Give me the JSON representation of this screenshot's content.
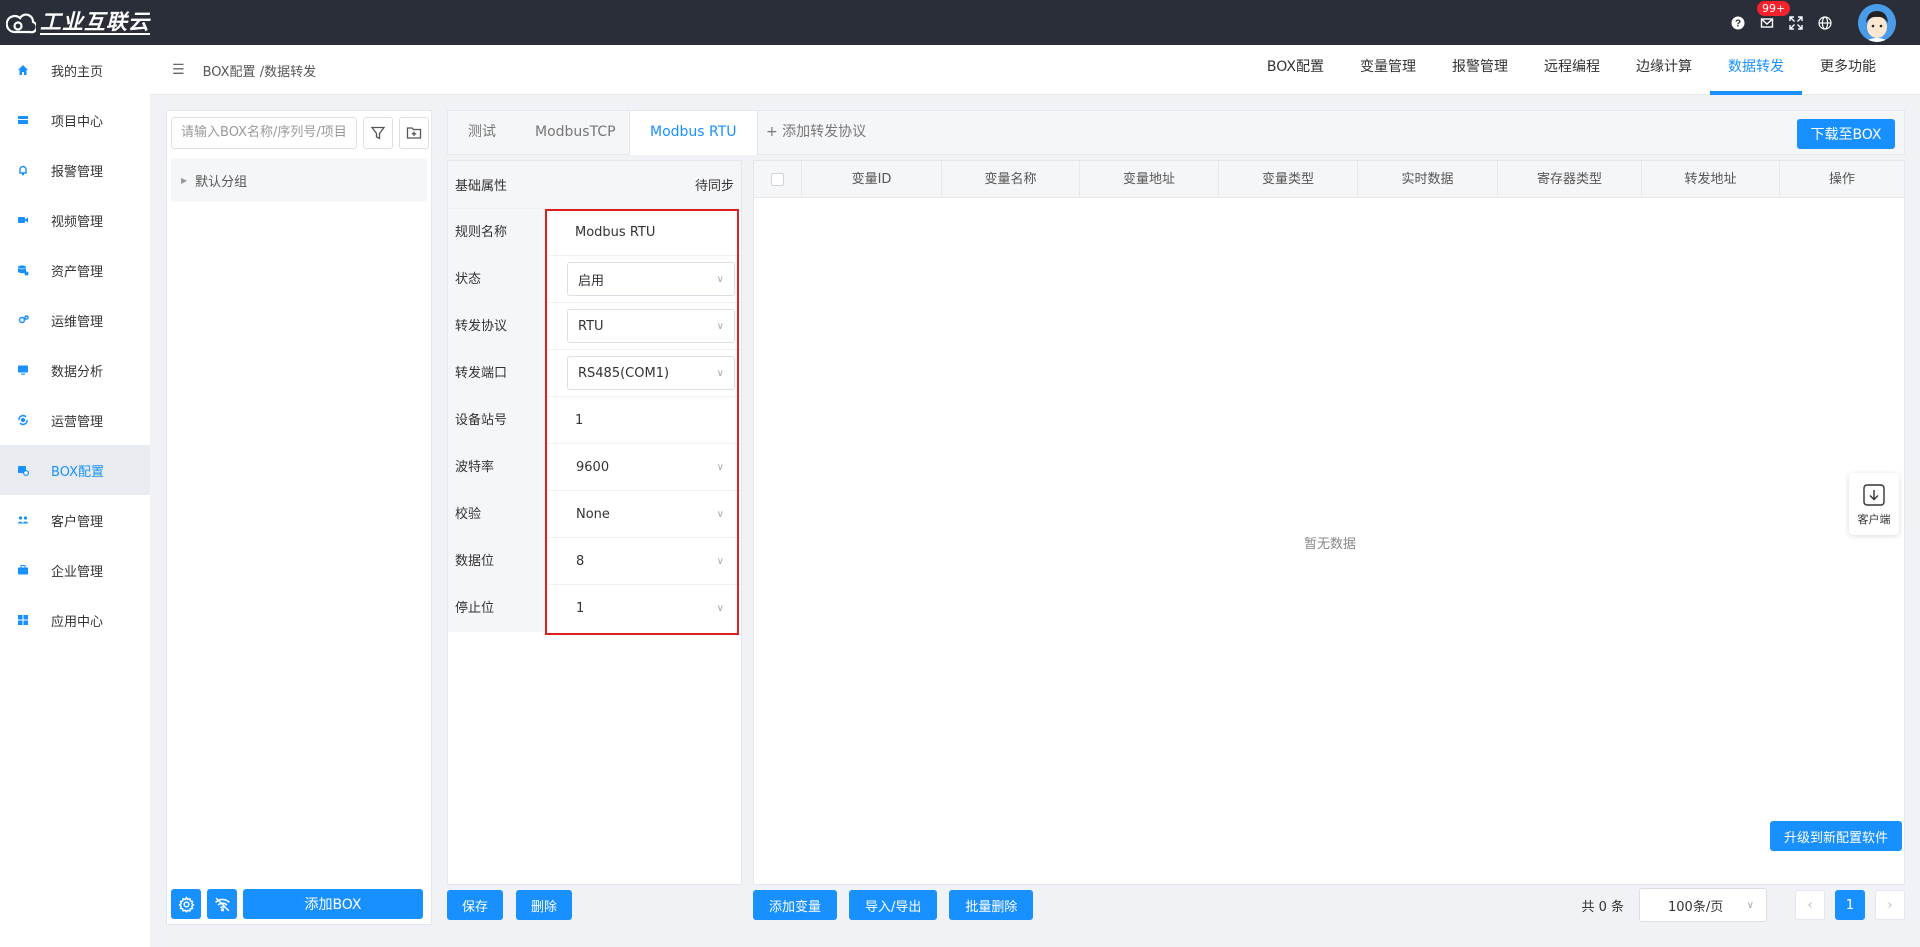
{
  "app": {
    "logo_text": "工业互联云",
    "notification_count": "99+"
  },
  "sidebar": {
    "items": [
      {
        "label": "我的主页",
        "icon": "home-icon"
      },
      {
        "label": "项目中心",
        "icon": "folder-icon"
      },
      {
        "label": "报警管理",
        "icon": "bell-icon"
      },
      {
        "label": "视频管理",
        "icon": "video-icon"
      },
      {
        "label": "资产管理",
        "icon": "asset-icon"
      },
      {
        "label": "运维管理",
        "icon": "gear-icon"
      },
      {
        "label": "数据分析",
        "icon": "monitor-icon"
      },
      {
        "label": "运营管理",
        "icon": "operation-icon"
      },
      {
        "label": "BOX配置",
        "icon": "box-icon",
        "active": true
      },
      {
        "label": "客户管理",
        "icon": "users-icon"
      },
      {
        "label": "企业管理",
        "icon": "briefcase-icon"
      },
      {
        "label": "应用中心",
        "icon": "apps-icon"
      }
    ]
  },
  "header": {
    "breadcrumb": "BOX配置 /数据转发",
    "nav": [
      "BOX配置",
      "变量管理",
      "报警管理",
      "远程编程",
      "边缘计算",
      "数据转发",
      "更多功能"
    ],
    "active_nav": "数据转发"
  },
  "boxpanel": {
    "search_placeholder": "请输入BOX名称/序列号/项目",
    "group_label": "默认分组",
    "add_box_label": "添加BOX"
  },
  "tabs": {
    "items": [
      "测试",
      "ModbusTCP",
      "Modbus RTU"
    ],
    "active": "Modbus RTU",
    "add_label": "+ 添加转发协议",
    "download_label": "下载至BOX"
  },
  "form": {
    "header_label": "基础属性",
    "sync_status": "待同步",
    "rows": [
      {
        "label": "规则名称",
        "value": "Modbus RTU",
        "type": "input"
      },
      {
        "label": "状态",
        "value": "启用",
        "type": "select"
      },
      {
        "label": "转发协议",
        "value": "RTU",
        "type": "select"
      },
      {
        "label": "转发端口",
        "value": "RS485(COM1)",
        "type": "select"
      },
      {
        "label": "设备站号",
        "value": "1",
        "type": "input"
      },
      {
        "label": "波特率",
        "value": "9600",
        "type": "select"
      },
      {
        "label": "校验",
        "value": "None",
        "type": "select"
      },
      {
        "label": "数据位",
        "value": "8",
        "type": "select"
      },
      {
        "label": "停止位",
        "value": "1",
        "type": "select"
      }
    ],
    "save_label": "保存",
    "delete_label": "删除"
  },
  "table": {
    "columns": [
      "变量ID",
      "变量名称",
      "变量地址",
      "变量类型",
      "实时数据",
      "寄存器类型",
      "转发地址",
      "操作"
    ],
    "empty_text": "暂无数据",
    "upgrade_label": "升级到新配置软件",
    "add_var_label": "添加变量",
    "import_export_label": "导入/导出",
    "batch_delete_label": "批量删除"
  },
  "pager": {
    "total_text": "共 0 条",
    "page_size": "100条/页",
    "current_page": "1"
  },
  "client_widget": {
    "label": "客户端"
  },
  "colors": {
    "accent": "#1890ff",
    "topbar": "#2a2e39",
    "highlight": "#e02020"
  }
}
